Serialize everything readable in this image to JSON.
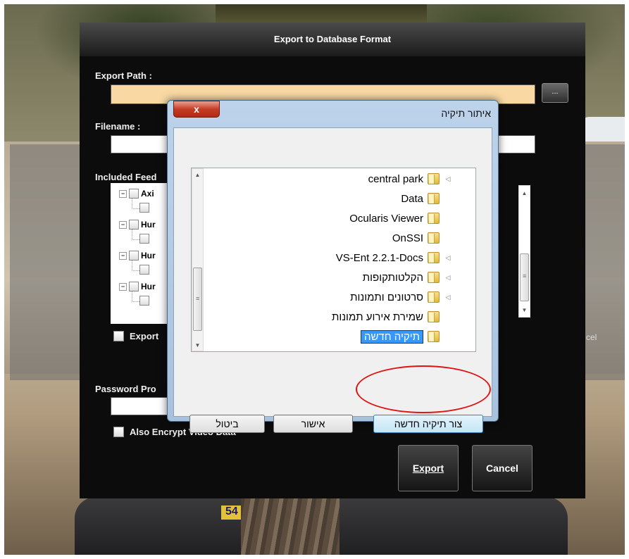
{
  "export_dialog": {
    "title": "Export to Database Format",
    "export_path_label": "Export Path :",
    "browse_label": "...",
    "filename_label": "Filename :",
    "included_feeds_label": "Included Feed",
    "feeds": [
      {
        "label": "Axi"
      },
      {
        "label": "Hur"
      },
      {
        "label": "Hur"
      },
      {
        "label": "Hur"
      }
    ],
    "export_checkbox_label": "Export",
    "password_label": "Password Pro",
    "encrypt_label": "Also Encrypt Video Data",
    "export_button": "Export",
    "cancel_button": "Cancel",
    "side_cancel_fragment": "cel"
  },
  "folder_dialog": {
    "title": "איתור תיקיה",
    "close_label": "x",
    "folders": [
      {
        "name": "central park",
        "expandable": true
      },
      {
        "name": "Data",
        "expandable": false
      },
      {
        "name": "Ocularis Viewer",
        "expandable": false
      },
      {
        "name": "OnSSI",
        "expandable": false
      },
      {
        "name": "VS-Ent 2.2.1-Docs",
        "expandable": true
      },
      {
        "name": "הקלטותקופות",
        "expandable": true
      },
      {
        "name": "סרטונים ותמונות",
        "expandable": true
      },
      {
        "name": "שמירת אירוע תמונות",
        "expandable": false
      },
      {
        "name": "תיקיה חדשה",
        "expandable": false,
        "selected": true
      }
    ],
    "new_folder_button": "צור תיקיה חדשה",
    "ok_button": "אישור",
    "cancel_button": "ביטול"
  },
  "background": {
    "plate_text": "54"
  }
}
